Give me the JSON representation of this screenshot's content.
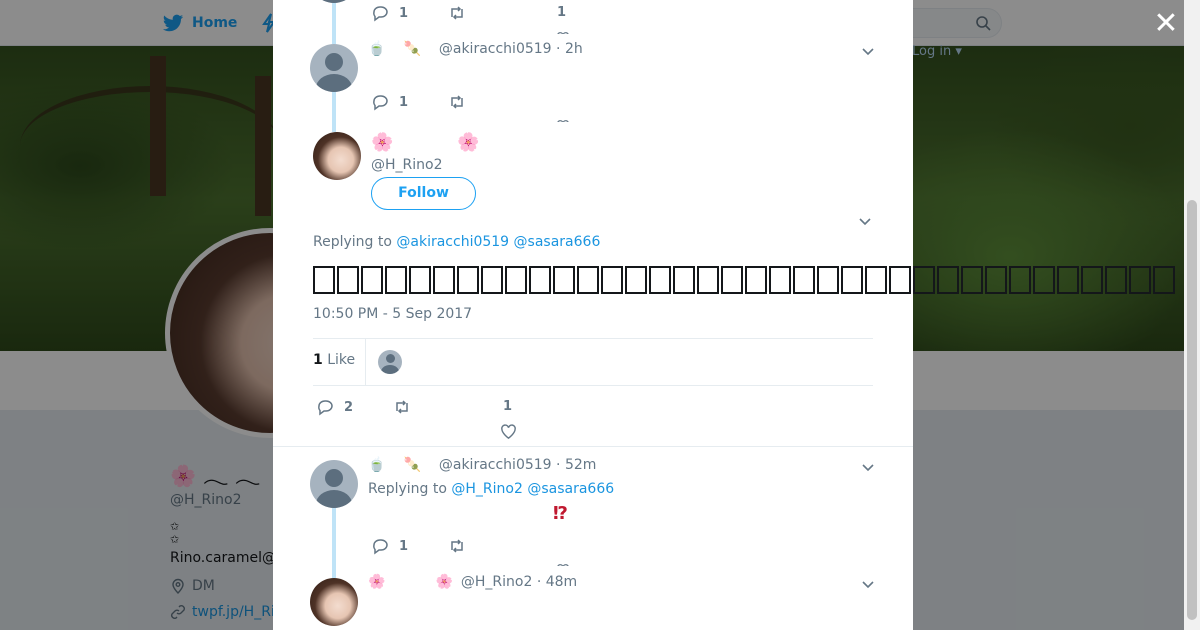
{
  "topbar": {
    "home_label": "Home",
    "login_label": "Log in ▾"
  },
  "profile": {
    "display_name": "🌸 𓂃 𓂃",
    "handle": "@H_Rino2",
    "stars_line": "✩ ✩",
    "email": "Rino.caramel@",
    "location": "DM",
    "link": "twpf.jp/H_Ri"
  },
  "modal": {
    "close_label": "✕",
    "tweet_top": {
      "reply_count": "1",
      "like_count": "1"
    },
    "tweet_a": {
      "emoji_1": "🍵",
      "emoji_2": "🍡",
      "handle": "@akiracchi0519",
      "time": "2h",
      "reply_count": "1"
    },
    "main_tweet": {
      "name_emoji_left": "🌸",
      "name_emoji_right": "🌸",
      "handle": "@H_Rino2",
      "follow_label": "Follow",
      "replying_prefix": "Replying to",
      "replying_to": [
        "@akiracchi0519",
        "@sasara666"
      ],
      "timestamp": "10:50 PM - 5 Sep 2017",
      "likes_count": "1",
      "likes_label": "Like",
      "reply_count": "2",
      "like_count": "1"
    },
    "tweet_b": {
      "emoji_1": "🍵",
      "emoji_2": "🍡",
      "handle": "@akiracchi0519",
      "time": "52m",
      "replying_prefix": "Replying to",
      "replying_to": [
        "@H_Rino2",
        "@sasara666"
      ],
      "text": "⁉",
      "reply_count": "1"
    },
    "tweet_c": {
      "name_emoji_left": "🌸",
      "name_emoji_right": "🌸",
      "handle": "@H_Rino2",
      "time": "48m"
    }
  }
}
